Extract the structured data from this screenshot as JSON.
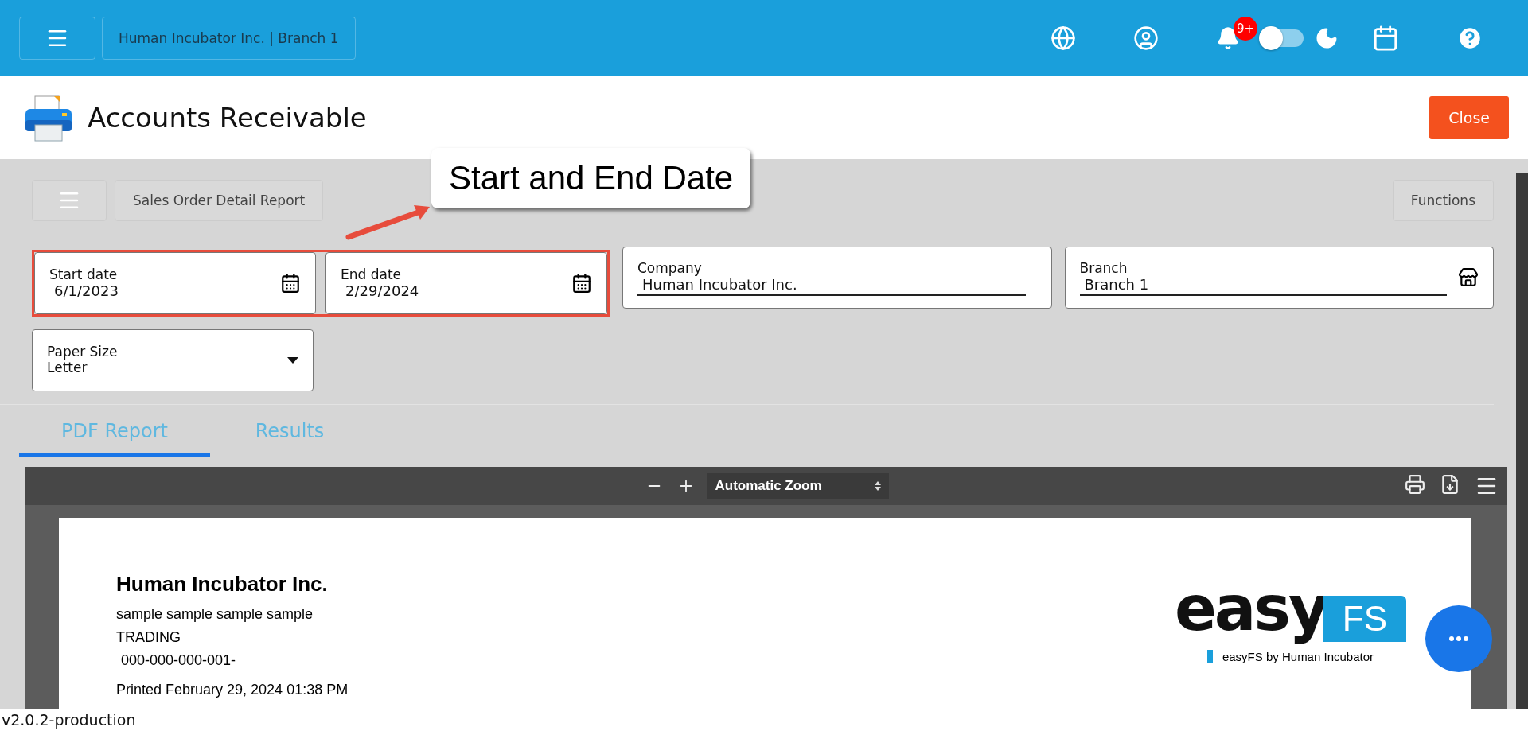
{
  "header": {
    "company_branch": "Human Incubator Inc. | Branch 1",
    "notification_count": "9+",
    "dark_mode": false
  },
  "page": {
    "title": "Accounts Receivable",
    "close_label": "Close"
  },
  "toolbar": {
    "report_name": "Sales Order Detail Report",
    "functions_label": "Functions"
  },
  "annotation": {
    "text": "Start and End Date"
  },
  "fields": [
    {
      "kind": "date",
      "label": "Start date",
      "value": "6/1/2023"
    },
    {
      "kind": "date",
      "label": "End date",
      "value": "2/29/2024"
    },
    {
      "kind": "text",
      "label": "Company",
      "value": "Human Incubator Inc."
    },
    {
      "kind": "store",
      "label": "Branch",
      "value": "Branch 1"
    }
  ],
  "paper_size": {
    "label": "Paper Size",
    "value": "Letter"
  },
  "tabs": [
    {
      "label": "PDF Report",
      "selected": true
    },
    {
      "label": "Results",
      "selected": false
    }
  ],
  "pdf_viewer": {
    "zoom": "Automatic Zoom",
    "document": {
      "company": "Human Incubator Inc.",
      "lines": [
        "sample sample sample sample",
        "TRADING",
        "000-000-000-001-"
      ],
      "printed": "Printed February 29, 2024 01:38 PM",
      "logo_word": "easy",
      "logo_badge": "FS",
      "logo_caption": "easyFS by Human Incubator"
    }
  },
  "version": "v2.0.2-production"
}
